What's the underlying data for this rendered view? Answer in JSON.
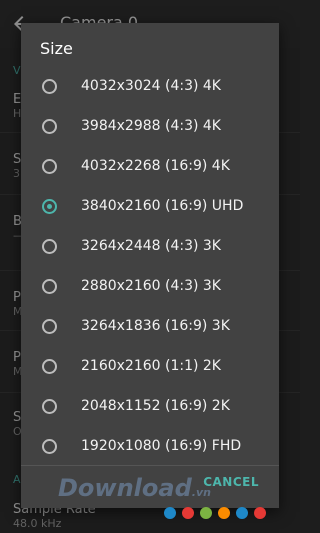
{
  "appbar": {
    "title": "Camera 0"
  },
  "background": {
    "section_initial": "V",
    "item1_title": "E",
    "item1_sub": "H",
    "item2_title": "S",
    "item2_sub": "3",
    "item3_title": "B",
    "item3_sub": "—",
    "item4_title": "P",
    "item4_sub": "M",
    "item5_title": "P",
    "item5_sub": "M",
    "item6_title": "S",
    "item6_sub": "O",
    "section2_initial": "A",
    "sample_rate_title": "Sample Rate",
    "sample_rate_value": "48.0 kHz"
  },
  "dialog": {
    "title": "Size",
    "selected_index": 3,
    "options": [
      {
        "label": "4032x3024 (4:3)  4K"
      },
      {
        "label": "3984x2988 (4:3)  4K"
      },
      {
        "label": "4032x2268 (16:9)  4K"
      },
      {
        "label": "3840x2160 (16:9)  UHD"
      },
      {
        "label": "3264x2448 (4:3)  3K"
      },
      {
        "label": "2880x2160 (4:3)  3K"
      },
      {
        "label": "3264x1836 (16:9)  3K"
      },
      {
        "label": "2160x2160 (1:1)  2K"
      },
      {
        "label": "2048x1152 (16:9)  2K"
      },
      {
        "label": "1920x1080 (16:9)  FHD"
      }
    ],
    "cancel_label": "CANCEL"
  },
  "watermark": {
    "text": "Download",
    "tld": ".vn",
    "dot_colors": [
      "#1e88c8",
      "#e53935",
      "#7cb342",
      "#fb8c00",
      "#1e88c8",
      "#e53935"
    ]
  },
  "colors": {
    "accent": "#4db6ac",
    "dialog_bg": "#424242",
    "screen_bg": "#2b2b2b"
  }
}
